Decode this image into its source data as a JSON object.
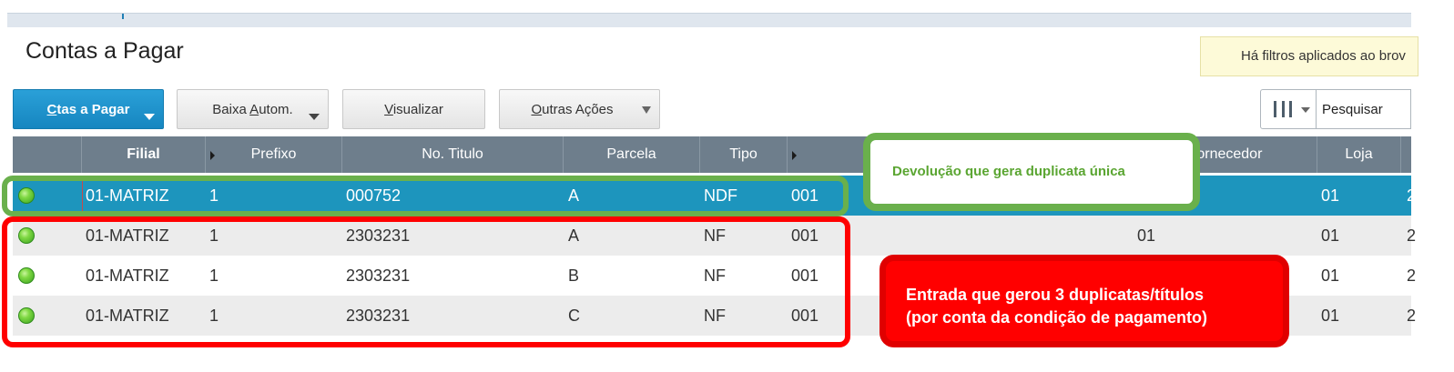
{
  "page": {
    "title": "Contas a Pagar",
    "filter_notice": "Há filtros aplicados ao brov"
  },
  "toolbar": {
    "ctas_label": "Ctas a Pagar",
    "baixa_label": "Baixa Autom.",
    "visualizar_label": "Visualizar",
    "outras_label": "Outras Ações",
    "search_placeholder": "Pesquisar"
  },
  "grid": {
    "columns": {
      "filial": "Filial",
      "prefixo": "Prefixo",
      "no_titulo": "No. Titulo",
      "parcela": "Parcela",
      "tipo": "Tipo",
      "fornecedor": "Fornecedor",
      "loja": "Loja"
    },
    "rows": [
      {
        "filial": "01-MATRIZ",
        "prefixo": "1",
        "no_titulo": "000752",
        "parcela": "A",
        "tipo": "NDF",
        "col6": "001",
        "fornecedor": "",
        "loja": "01",
        "status": "green",
        "selected": true
      },
      {
        "filial": "01-MATRIZ",
        "prefixo": "1",
        "no_titulo": "2303231",
        "parcela": "A",
        "tipo": "NF",
        "col6": "001",
        "fornecedor": "01",
        "loja": "01",
        "status": "green",
        "selected": false
      },
      {
        "filial": "01-MATRIZ",
        "prefixo": "1",
        "no_titulo": "2303231",
        "parcela": "B",
        "tipo": "NF",
        "col6": "001",
        "fornecedor": "",
        "loja": "01",
        "status": "green",
        "selected": false
      },
      {
        "filial": "01-MATRIZ",
        "prefixo": "1",
        "no_titulo": "2303231",
        "parcela": "C",
        "tipo": "NF",
        "col6": "001",
        "fornecedor": "",
        "loja": "01",
        "status": "green",
        "selected": false
      }
    ]
  },
  "annotations": {
    "green_text": "Devolução que gera duplicata única",
    "red_line1": "Entrada que gerou 3 duplicatas/títulos",
    "red_line2": "(por conta da condição de pagamento)"
  },
  "colors": {
    "primary_button": "#1d95bd",
    "header_bg": "#6e7e8c",
    "selected_row": "#1d95bd",
    "callout_green": "#6ab04c",
    "callout_red": "#ff0000",
    "status_green": "#5cc02a"
  },
  "icons": {
    "status": "status-green-icon",
    "columns": "columns-icon",
    "dropdown": "chevron-down-icon"
  }
}
